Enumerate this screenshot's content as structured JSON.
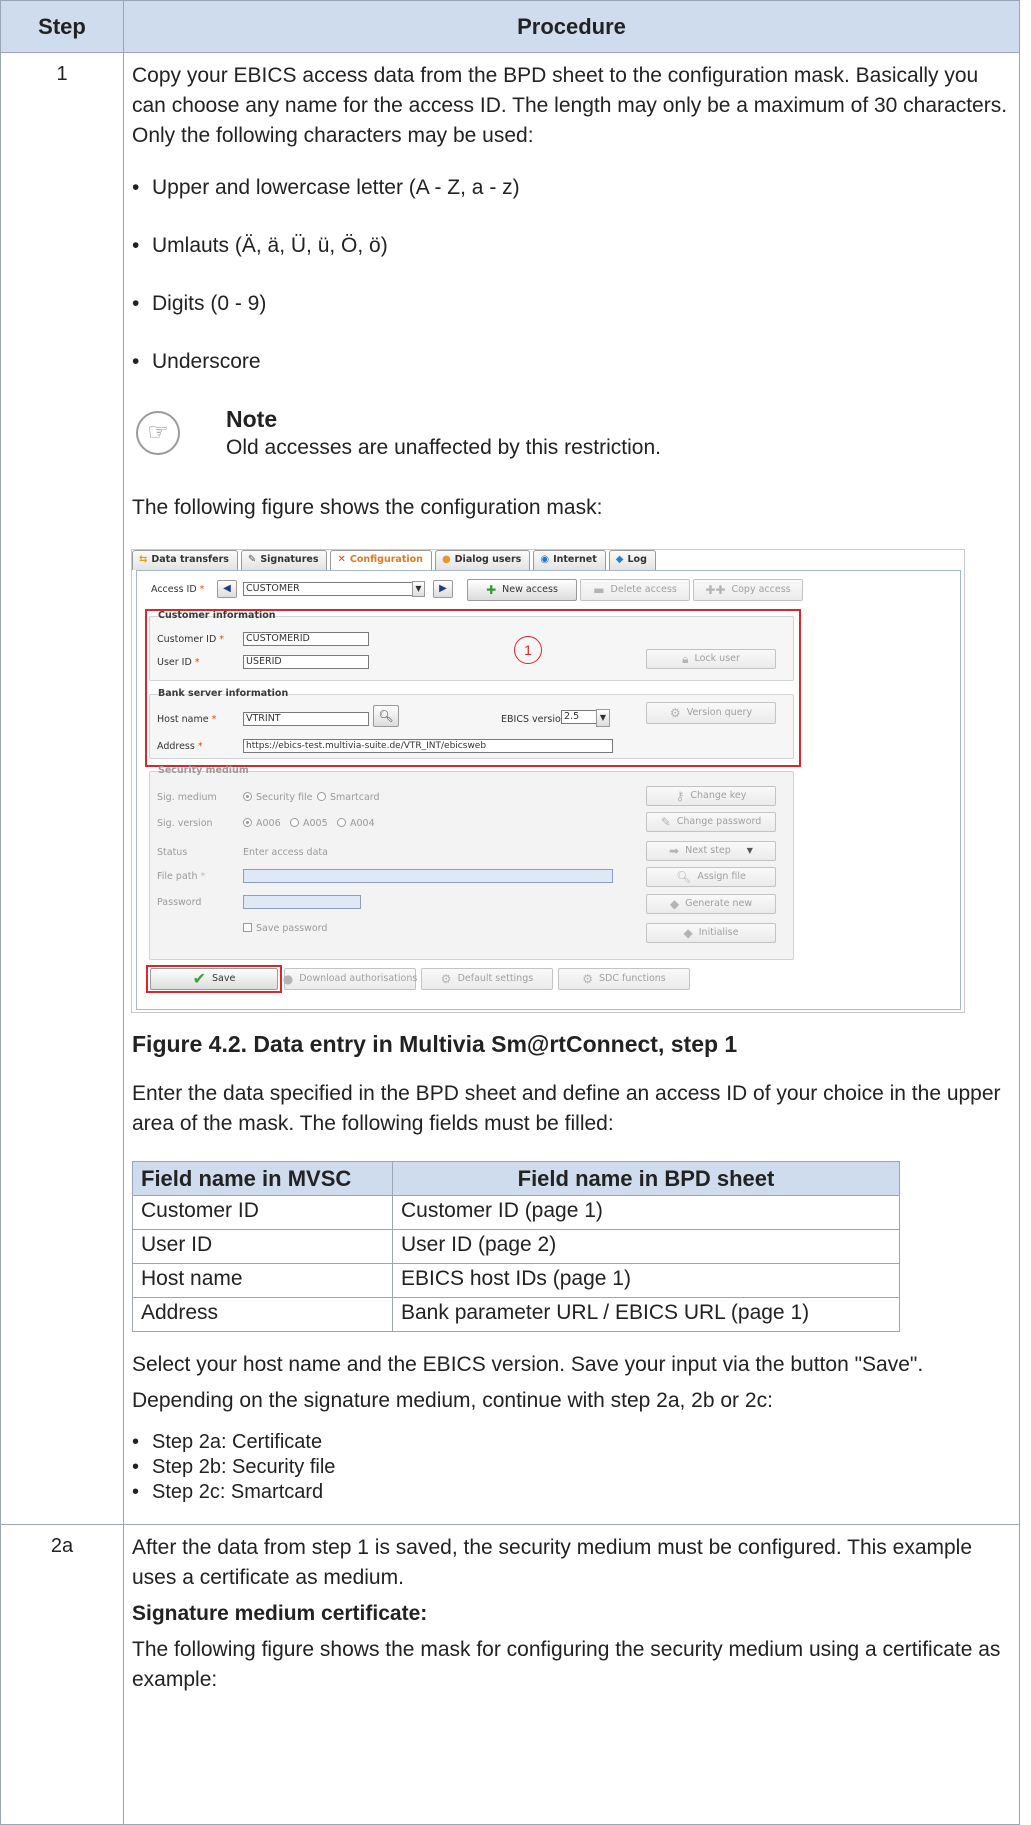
{
  "table": {
    "col_step": "Step",
    "col_procedure": "Procedure"
  },
  "step1": {
    "number": "1",
    "intro": "Copy your EBICS access data from the BPD sheet to the configuration mask. Basically you can choose any name for the access ID. The length may only be a maximum of 30 characters. Only the following characters may be used:",
    "bullets": [
      "Upper and lowercase letter (A - Z, a - z)",
      "Umlauts (Ä, ä, Ü, ü, Ö, ö)",
      "Digits (0 - 9)",
      "Underscore"
    ],
    "note_title": "Note",
    "note_text": "Old accesses are unaffected by this restriction.",
    "figure_intro": "The following figure shows the configuration mask:",
    "caption": "Figure 4.2. Data entry in Multivia Sm@rtConnect, step 1",
    "after_figure": "Enter the data specified in the BPD sheet and define an access ID of your choice in the upper area of the mask. The following fields must be filled:",
    "fields_table": {
      "headers": [
        "Field name in MVSC",
        "Field name in BPD sheet"
      ],
      "rows": [
        [
          "Customer ID",
          "Customer ID (page 1)"
        ],
        [
          "User ID",
          "User ID (page 2)"
        ],
        [
          "Host name",
          "EBICS host IDs (page 1)"
        ],
        [
          "Address",
          "Bank parameter URL / EBICS URL (page 1)"
        ]
      ]
    },
    "select_text": "Select your host name and the EBICS version. Save your input via the button \"Save\".",
    "depending_text": "Depending on the signature medium, continue with step 2a, 2b or 2c:",
    "step_list": [
      "Step 2a: Certificate",
      "Step 2b: Security file",
      "Step 2c: Smartcard"
    ]
  },
  "step2a": {
    "number": "2a",
    "intro": "After the data from step 1 is saved, the security medium must be configured. This example uses a certificate as medium.",
    "heading": "Signature medium certificate:",
    "text": "The following figure shows the mask for configuring the security medium using a certificate as example:"
  },
  "screenshot": {
    "tabs": [
      {
        "label": "Data transfers",
        "icon": "transfer-icon"
      },
      {
        "label": "Signatures",
        "icon": "pen-icon"
      },
      {
        "label": "Configuration",
        "icon": "tools-icon"
      },
      {
        "label": "Dialog users",
        "icon": "users-icon"
      },
      {
        "label": "Internet",
        "icon": "globe-icon"
      },
      {
        "label": "Log",
        "icon": "diamond-icon"
      }
    ],
    "access_id_label": "Access ID",
    "access_id_value": "CUSTOMER",
    "new_access": "New access",
    "delete_access": "Delete access",
    "copy_access": "Copy access",
    "customer_info_title": "Customer information",
    "customer_id_label": "Customer ID",
    "customer_id_value": "CUSTOMERID",
    "user_id_label": "User ID",
    "user_id_value": "USERID",
    "callout": "1",
    "lock_user": "Lock user",
    "bank_server_title": "Bank server information",
    "host_name_label": "Host name",
    "host_name_value": "VTRINT",
    "ebics_version_label": "EBICS version",
    "ebics_version_value": "2.5",
    "version_query": "Version query",
    "address_label": "Address",
    "address_value": "https://ebics-test.multivia-suite.de/VTR_INT/ebicsweb",
    "security_title": "Security medium",
    "sig_medium_label": "Sig. medium",
    "sig_medium_options": [
      "Security file",
      "Smartcard"
    ],
    "change_key": "Change key",
    "sig_version_label": "Sig. version",
    "sig_version_options": [
      "A006",
      "A005",
      "A004"
    ],
    "change_password": "Change password",
    "status_label": "Status",
    "status_value": "Enter access data",
    "next_step": "Next step",
    "file_path_label": "File path",
    "assign_file": "Assign file",
    "password_label": "Password",
    "generate_new": "Generate new",
    "save_password": "Save password",
    "initialise": "Initialise",
    "save": "Save",
    "download_authorisations": "Download authorisations",
    "default_settings": "Default settings",
    "sdc_functions": "SDC functions"
  }
}
